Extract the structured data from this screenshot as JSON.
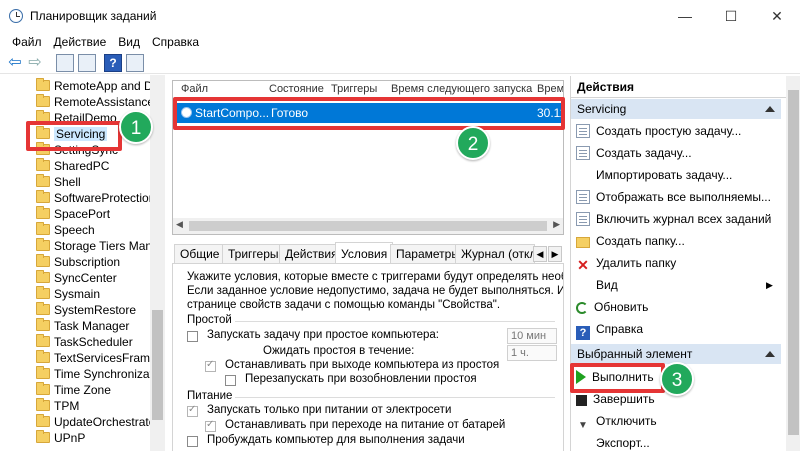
{
  "window": {
    "title": "Планировщик заданий",
    "controls": {
      "minimize": "—",
      "maximize": "☐",
      "close": "✕"
    }
  },
  "menu": [
    "Файл",
    "Действие",
    "Вид",
    "Справка"
  ],
  "toolbar": {
    "back_icon": "arrow-left-icon",
    "forward_icon": "arrow-right-icon",
    "help_label": "?"
  },
  "tree": {
    "items": [
      "RemoteApp and De",
      "RemoteAssistance",
      "RetailDemo",
      "Servicing",
      "SettingSync",
      "SharedPC",
      "Shell",
      "SoftwareProtectionP",
      "SpacePort",
      "Speech",
      "Storage Tiers Manag",
      "Subscription",
      "SyncCenter",
      "Sysmain",
      "SystemRestore",
      "Task Manager",
      "TaskScheduler",
      "TextServicesFramew",
      "Time Synchronizatio",
      "Time Zone",
      "TPM",
      "UpdateOrchestrator",
      "UPnP"
    ],
    "selected": "Servicing"
  },
  "tasklist": {
    "columns": [
      "Файл",
      "Состояние",
      "Триггеры",
      "Время следующего запуска",
      "Врем"
    ],
    "rows": [
      {
        "name": "StartCompo...",
        "status": "Готово",
        "time": "30.11"
      }
    ]
  },
  "tabs": [
    "Общие",
    "Триггеры",
    "Действия",
    "Условия",
    "Параметры",
    "Журнал (откл"
  ],
  "active_tab": "Условия",
  "conditions": {
    "intro": [
      "Укажите условия, которые вместе с триггерами будут определять необх",
      "Если заданное условие недопустимо, задача не будет выполняться.  Изм",
      "странице свойств задачи с помощью команды \"Свойства\"."
    ],
    "idle_header": "Простой",
    "idle_start_label": "Запускать задачу при простое компьютера:",
    "idle_start_value": "10 мин",
    "idle_wait_label": "Ожидать простоя в течение:",
    "idle_wait_value": "1 ч.",
    "idle_stop_label": "Останавливать при выходе компьютера из простоя",
    "idle_restart_label": "Перезапускать при возобновлении простоя",
    "power_header": "Питание",
    "power_ac_label": "Запускать только при питании от электросети",
    "power_battery_label": "Останавливать при переходе на питание от батарей",
    "power_wake_label": "Пробуждать компьютер для выполнения задачи"
  },
  "actions": {
    "title": "Действия",
    "section1": "Servicing",
    "items1": [
      {
        "label": "Создать простую задачу...",
        "icon": "document-icon"
      },
      {
        "label": "Создать задачу...",
        "icon": "document-icon"
      },
      {
        "label": "Импортировать задачу...",
        "icon": "none"
      },
      {
        "label": "Отображать все выполняемы...",
        "icon": "document-icon"
      },
      {
        "label": "Включить журнал всех заданий",
        "icon": "document-icon"
      },
      {
        "label": "Создать папку...",
        "icon": "folder-icon"
      },
      {
        "label": "Удалить папку",
        "icon": "delete-icon"
      },
      {
        "label": "Вид",
        "icon": "none"
      },
      {
        "label": "Обновить",
        "icon": "refresh-icon"
      },
      {
        "label": "Справка",
        "icon": "help-icon"
      }
    ],
    "section2": "Выбранный элемент",
    "items2": [
      {
        "label": "Выполнить",
        "icon": "play-icon"
      },
      {
        "label": "Завершить",
        "icon": "stop-icon"
      },
      {
        "label": "Отключить",
        "icon": "arrow-down-icon"
      },
      {
        "label": "Экспорт...",
        "icon": "none"
      }
    ]
  },
  "badges": [
    "1",
    "2",
    "3"
  ],
  "colors": {
    "highlight": "#e53535",
    "badge": "#22a95c",
    "selection": "#0078d7",
    "section_bg": "#d9e5f3"
  }
}
